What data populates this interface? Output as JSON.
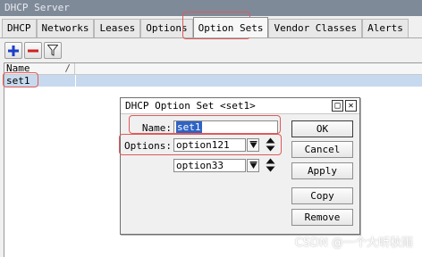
{
  "window": {
    "title": "DHCP Server"
  },
  "tabs": [
    {
      "label": "DHCP"
    },
    {
      "label": "Networks"
    },
    {
      "label": "Leases"
    },
    {
      "label": "Options"
    },
    {
      "label": "Option Sets",
      "active": true
    },
    {
      "label": "Vendor Classes"
    },
    {
      "label": "Alerts"
    }
  ],
  "toolbar": {
    "add_icon": "plus-icon",
    "remove_icon": "minus-icon",
    "filter_icon": "funnel-icon"
  },
  "list": {
    "column_name": "Name",
    "sort_glyph": "/",
    "rows": [
      {
        "name": "set1"
      }
    ]
  },
  "dialog": {
    "title": "DHCP Option Set <set1>",
    "name_label": "Name:",
    "name_value": "set1",
    "options_label": "Options:",
    "options": [
      "option121",
      "option33"
    ],
    "buttons": {
      "ok": "OK",
      "cancel": "Cancel",
      "apply": "Apply",
      "copy": "Copy",
      "remove": "Remove"
    },
    "controls": {
      "restore": "□",
      "close": "✕"
    }
  },
  "colors": {
    "highlight": "#e05a5a",
    "selection": "#2f63c4",
    "row_selected": "#c7d9ee"
  },
  "watermark": "CSDN @一个大听秋雨"
}
